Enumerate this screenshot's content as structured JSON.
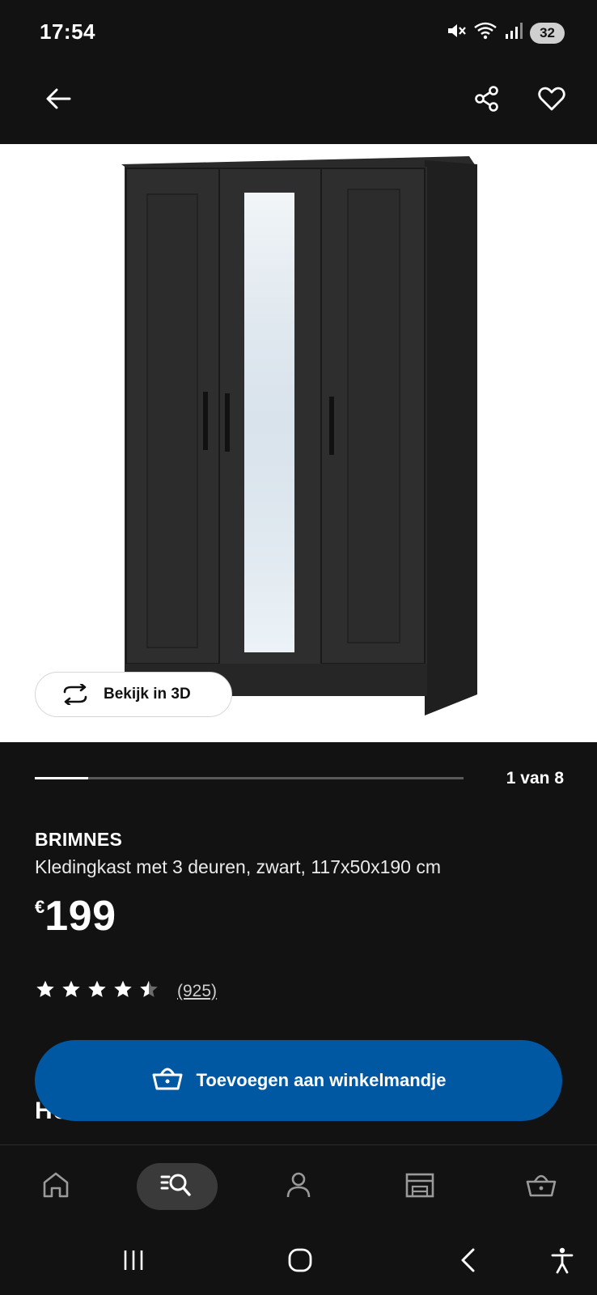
{
  "status_bar": {
    "time": "17:54",
    "battery": "32",
    "icons": [
      "mute-icon",
      "wifi-icon",
      "signal-icon",
      "battery-icon"
    ]
  },
  "top_bar": {
    "icons": [
      "back-arrow-icon",
      "share-icon",
      "heart-icon"
    ]
  },
  "gallery": {
    "view_3d_label": "Bekijk in 3D",
    "page_label": "1 van 8",
    "current_page": 1,
    "total_pages": 8
  },
  "product": {
    "name": "BRIMNES",
    "description": "Kledingkast met 3 deuren, zwart, 117x50x190 cm",
    "price_currency": "€",
    "price_amount": "199",
    "rating_value": 4.5,
    "rating_max": 5,
    "review_count": "(925)"
  },
  "obscured_heading": "Ho",
  "cart_button": {
    "label": "Toevoegen aan winkelmandje"
  },
  "bottom_nav": {
    "items": [
      {
        "icon": "home-icon",
        "active": false
      },
      {
        "icon": "search-icon",
        "active": true
      },
      {
        "icon": "profile-icon",
        "active": false
      },
      {
        "icon": "store-icon",
        "active": false
      },
      {
        "icon": "basket-icon",
        "active": false
      }
    ]
  },
  "colors": {
    "background": "#121212",
    "accent_blue": "#0058a3",
    "text": "#ffffff"
  }
}
